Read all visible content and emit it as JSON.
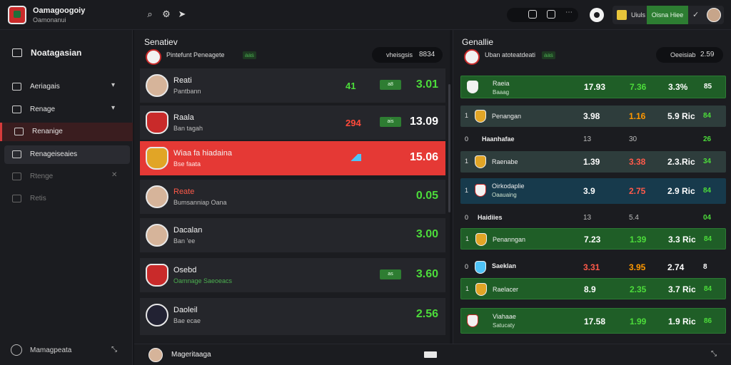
{
  "app": {
    "title": "Oamagoogoiy",
    "subtitle": "Oamonanui"
  },
  "topbar": {
    "user_label": "Uiuls",
    "green_label": "Oisna Hiee",
    "check_icon": "check-icon",
    "icons": [
      "search-icon",
      "settings-icon",
      "send-icon",
      "calendar-icon",
      "calendar-icon",
      "more-icon",
      "gear-icon"
    ]
  },
  "sidebar": {
    "header": "Noatagasian",
    "items": [
      {
        "label": "Aeriagais",
        "icon": "car-icon",
        "chevron": "▾"
      },
      {
        "label": "Renage",
        "icon": "chart-icon",
        "chevron": "▾"
      },
      {
        "label": "Renanige",
        "icon": "flag-icon"
      },
      {
        "label": "Renageiseaies",
        "icon": "grid-icon"
      },
      {
        "label": "Rtenge",
        "icon": "clock-icon",
        "tool": "✕"
      },
      {
        "label": "Retis",
        "icon": "box-icon"
      }
    ],
    "footer": "Mamagpeata",
    "footer_tool": "⤡"
  },
  "middle": {
    "title": "Senatiev",
    "subtitle": "Pintefunt Peneagete",
    "sub_tag": "aas",
    "filter_label": "vheisgsis",
    "filter_value": "8834",
    "rows": [
      {
        "name": "Reati",
        "sub": "Pantbann",
        "delta": "41",
        "delta_color": "#4cdc3a",
        "tag": "a8",
        "value": "3.01"
      },
      {
        "name": "Raala",
        "sub": "Ban tagah",
        "delta": "294",
        "delta_color": "#ff4a3a",
        "tag": "ais",
        "value": "13.09"
      },
      {
        "name": "Wiaa fa hiadaina",
        "sub": "Bse faata",
        "value": "15.06"
      },
      {
        "name": "Reate",
        "sub": "Bumsanniap Oana",
        "value": "0.05"
      },
      {
        "name": "Dacalan",
        "sub": "Ban 'ee",
        "value": "3.00"
      },
      {
        "name": "Osebd",
        "sub": "Oamnage Saeoeacs",
        "tag": "as",
        "value": "3.60"
      },
      {
        "name": "Daoleil",
        "sub": "Bae ecae",
        "value": "2.56"
      }
    ]
  },
  "right": {
    "title": "Genallie",
    "subtitle": "Uban atoteatdeati",
    "sub_tag": "aas",
    "filter_label": "Oeeisiab",
    "filter_value": "2.59",
    "rows": [
      {
        "style": "green",
        "name": "Raeia",
        "sub": "Baaag",
        "c1": "17.93",
        "c2": "7.36",
        "c2c": "green-txt",
        "c3": "3.3%",
        "c4": "85"
      },
      {
        "style": "gray",
        "rank": "1",
        "name": "Penangan",
        "c1": "3.98",
        "c2": "1.16",
        "c2c": "orange-txt",
        "c3": "5.9 Ric",
        "c4": "84"
      },
      {
        "style": "plain",
        "rank": "0",
        "name": "Haanhafae",
        "c1": "13",
        "c2": "30",
        "c3": "",
        "c4": "26"
      },
      {
        "style": "gray",
        "rank": "1",
        "name": "Raenabe",
        "c1": "1.39",
        "c2": "3.38",
        "c2c": "red-txt",
        "c3": "2.3.Ric",
        "c4": "34"
      },
      {
        "style": "blue",
        "rank": "1",
        "name": "Oirkodaplie",
        "sub": "Oaauaing",
        "c1": "3.9",
        "c2": "2.75",
        "c2c": "red-txt",
        "c3": "2.9 Ric",
        "c4": "84"
      },
      {
        "style": "plain",
        "rank": "0",
        "name": "Haidiies",
        "c1": "13",
        "c2": "5.4",
        "c3": "",
        "c4": "04"
      },
      {
        "style": "green",
        "rank": "1",
        "name": "Penanngan",
        "c1": "7.23",
        "c2": "1.39",
        "c2c": "green-txt",
        "c3": "3.3 Ric",
        "c4": "84"
      },
      {
        "style": "plain",
        "rank": "0",
        "name": "Saeklan",
        "c1": "3.31",
        "c1c": "red-txt",
        "c2": "3.95",
        "c2c": "orange-txt",
        "c3": "2.74",
        "c4": "8"
      },
      {
        "style": "green",
        "rank": "1",
        "name": "Raelacer",
        "c1": "8.9",
        "c2": "2.35",
        "c2c": "green-txt",
        "c3": "3.7 Ric",
        "c4": "84"
      },
      {
        "style": "green",
        "name": "Viahaae",
        "sub": "Satucaty",
        "c1": "17.58",
        "c2": "1.99",
        "c2c": "green-txt",
        "c3": "1.9 Ric",
        "c4": "86"
      }
    ]
  },
  "bottombar": {
    "label": "Mageritaaga",
    "tool": "⤡"
  },
  "colors": {
    "accent_red": "#e53935",
    "accent_green": "#4cdc3a",
    "row_green": "#1f5e27",
    "bg": "#16171b"
  }
}
